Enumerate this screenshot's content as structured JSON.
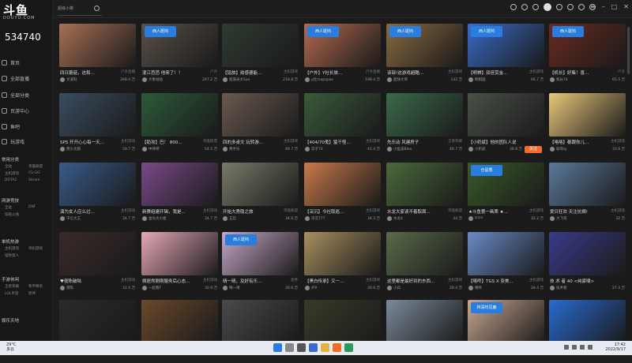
{
  "app": {
    "logo_main": "斗鱼",
    "logo_sub": "DOUYU.COM",
    "room_number": "534740",
    "search_placeholder": "超级小桀"
  },
  "sidebar": {
    "items": [
      {
        "label": "首页",
        "icon": "home-icon"
      },
      {
        "label": "全部直播",
        "icon": "live-icon"
      },
      {
        "label": "全部分类",
        "icon": "category-icon"
      },
      {
        "label": "页游中心",
        "icon": "webgame-icon"
      },
      {
        "label": "鱼吧",
        "icon": "fishbar-icon"
      },
      {
        "label": "玩游戏",
        "icon": "game-icon"
      }
    ],
    "sections": [
      {
        "title": "常用分类",
        "subs": [
          "全站",
          "英雄联盟",
          "主机游戏",
          "CS:GO",
          "DOTA2",
          "Steam"
        ]
      },
      {
        "title": "网游竞技",
        "subs": [
          "全站",
          "DNF",
          "穿越火线"
        ]
      },
      {
        "title": "单机热游",
        "subs": [
          "主机游戏",
          "单机游戏",
          "怪物猎人"
        ]
      },
      {
        "title": "手游休闲",
        "subs": [
          "王者荣耀",
          "和平精英",
          "LOL手游",
          "原神"
        ]
      },
      {
        "title": "娱乐天地"
      }
    ]
  },
  "cards": [
    {
      "title": "四日蘑菇，这和...",
      "cat": "户外直播",
      "anchor": "文溪科",
      "pop": "268.4 万",
      "bg": "#a87055",
      "badge": ""
    },
    {
      "title": "混江芭芭 他来了！！",
      "cat": "户外",
      "anchor": "大象咕咕",
      "pop": "247.2 万",
      "bg": "#5a5048",
      "badge": "西人斑鸠"
    },
    {
      "title": "【铭旅】勋感德能...",
      "cat": "主机游戏",
      "anchor": "铭旅米大Sao",
      "pop": "218.8 万",
      "bg": "#2f3a32",
      "badge": ""
    },
    {
      "title": "【户外】Y社长旅...",
      "cat": "户外直播",
      "anchor": "y社mapapas",
      "pop": "198.4 万",
      "bg": "#b36a50",
      "badge": "西人斑鸠"
    },
    {
      "title": "该部!这游戏超酷...",
      "cat": "主机游戏",
      "anchor": "超快大哥",
      "pop": "142 万",
      "bg": "#8a6a40",
      "badge": "西人斑鸠"
    },
    {
      "title": "【明棋】双倍赏金...",
      "cat": "主机游戏",
      "anchor": "明棋国",
      "pop": "66.7 万",
      "bg": "#3a6cc8",
      "badge": "西人斑鸠"
    },
    {
      "title": "【机长】好集！喜...",
      "cat": "户外",
      "anchor": "机长74",
      "pop": "65.5 万",
      "bg": "#6a2a20",
      "badge": "西人斑鸠"
    },
    {
      "title": "SPS 开开心心每一天...",
      "cat": "主机游戏",
      "anchor": "费头太狼",
      "pop": "59.7 万",
      "bg": "#3a4d60",
      "badge": ""
    },
    {
      "title": "【助攻】巴！ 800...",
      "cat": "英雄联盟",
      "anchor": "中神吧",
      "pop": "54.5 万",
      "bg": "#2d5a3a",
      "badge": ""
    },
    {
      "title": "四的多桌文 玩转游...",
      "cat": "主机游戏",
      "anchor": "费手乐",
      "pop": "49.7 万",
      "bg": "#6a5a50",
      "badge": ""
    },
    {
      "title": "【404/70鬼】猛干怪...",
      "cat": "主机游戏",
      "anchor": "凉子74",
      "pop": "41.4 万",
      "bg": "#3a5a3a",
      "badge": ""
    },
    {
      "title": "先乐动 风建房子",
      "cat": "王者荣耀",
      "anchor": "小鱼美Bleo",
      "pop": "40.7 万",
      "bg": "#3a6a4a",
      "badge": ""
    },
    {
      "title": "【小奶斌】他的团队人说...",
      "cat": "",
      "anchor": "小奶斌",
      "pop": "36.8 万",
      "bg": "#4a5048",
      "badge": ""
    },
    {
      "title": "【咯咯】都跟你儿...",
      "cat": "主机游戏",
      "anchor": "瑜哥ig",
      "pop": "33.6 万",
      "bg": "#e8c87a",
      "badge": ""
    },
    {
      "title": "演为女人应么过...",
      "cat": "主机游戏",
      "anchor": "千亿大王",
      "pop": "34.7 万",
      "bg": "#3a5a8a",
      "badge": ""
    },
    {
      "title": "新赛组建开辑，我是...",
      "cat": "主机游戏",
      "anchor": "金光大小姐",
      "pop": "34.7 万",
      "bg": "#7a4a8a",
      "badge": ""
    },
    {
      "title": "开始大秀隐之旅",
      "cat": "英雄联盟",
      "anchor": "五哲",
      "pop": "34.6 万",
      "bg": "#7a7a6a",
      "badge": ""
    },
    {
      "title": "【深沉】今社取巡...",
      "cat": "主机游戏",
      "anchor": "深沉777",
      "pop": "34.3 万",
      "bg": "#c87a4a",
      "badge": ""
    },
    {
      "title": "水龙大家读不着取周...",
      "cat": "英雄联盟",
      "anchor": "水龙4",
      "pop": "34 万",
      "bg": "#4a6a3a",
      "badge": ""
    },
    {
      "title": "★斗鱼第一画质 ★...",
      "cat": "主机游戏",
      "anchor": "Dico",
      "pop": "32.2 万",
      "bg": "#3a5a2a",
      "badge": "仓鼠香"
    },
    {
      "title": "爱日狂欢 天注抗搁!",
      "cat": "主机游戏",
      "anchor": "大飞哥",
      "pop": "32 万",
      "bg": "#5a7a9a",
      "badge": ""
    },
    {
      "title": "♥夜陈破陆",
      "cat": "主机游戏",
      "anchor": "夜陈",
      "pop": "31.6 万",
      "bg": "#3a2a2a",
      "badge": ""
    },
    {
      "title": "佩居然刚刚服务后心态...",
      "cat": "主机游戏",
      "anchor": "一起看F",
      "pop": "30.9 万",
      "bg": "#e8a8b8",
      "badge": ""
    },
    {
      "title": "晴一晴，及好有乐...",
      "cat": "星秀",
      "anchor": "晴一晴",
      "pop": "30.6 万",
      "bg": "#c8a8c8",
      "badge": "西人斑鸠"
    },
    {
      "title": "【黑白传承】又一...",
      "cat": "主机游戏",
      "anchor": "护P",
      "pop": "30.6 万",
      "bg": "#a89060",
      "badge": ""
    },
    {
      "title": "这里都是最好到的东西...",
      "cat": "主机游戏",
      "anchor": "小白",
      "pop": "28.4 万",
      "bg": "#5a6a4a",
      "badge": ""
    },
    {
      "title": "【嘻咚】TGS X 奈美...",
      "cat": "主机游戏",
      "anchor": "嘻咚",
      "pop": "28.4 万",
      "bg": "#6a8ac8",
      "badge": ""
    },
    {
      "title": "技 术 者 40 <纯家啸>",
      "cat": "",
      "anchor": "技术者",
      "pop": "27.4 万",
      "bg": "#3a3a8a",
      "badge": ""
    },
    {
      "title": "",
      "cat": "",
      "anchor": "",
      "pop": "",
      "bg": "#2a2a2a",
      "badge": ""
    },
    {
      "title": "",
      "cat": "",
      "anchor": "",
      "pop": "",
      "bg": "#6a4a2a",
      "badge": ""
    },
    {
      "title": "",
      "cat": "",
      "anchor": "",
      "pop": "",
      "bg": "#4a4a4a",
      "badge": ""
    },
    {
      "title": "",
      "cat": "",
      "anchor": "",
      "pop": "",
      "bg": "#3a3a2a",
      "badge": ""
    },
    {
      "title": "",
      "cat": "",
      "anchor": "",
      "pop": "",
      "bg": "#7a8a9a",
      "badge": ""
    },
    {
      "title": "",
      "cat": "",
      "anchor": "",
      "pop": "",
      "bg": "#c8a890",
      "badge": "林深时见鹿"
    },
    {
      "title": "",
      "cat": "",
      "anchor": "",
      "pop": "",
      "bg": "#2a6ad0",
      "badge": ""
    }
  ],
  "follow_label": "关注",
  "taskbar": {
    "weather_temp": "29°C",
    "weather_text": "多云",
    "time": "17:42",
    "date": "2022/9/17"
  },
  "colors": {
    "accent": "#f26b2a",
    "badge_blue": "#2a7de0"
  }
}
